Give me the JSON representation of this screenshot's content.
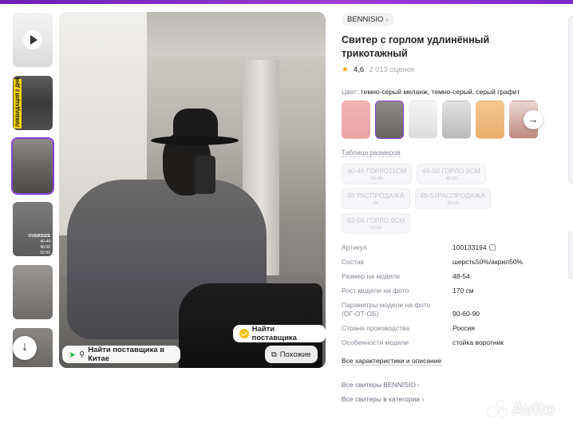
{
  "gallery": {
    "thumb_tag": "ЛИКВИДАЦИЯ 2 ДНЯ",
    "thumb_oversize": {
      "label": "OVERSIZE",
      "lines": [
        "40-44",
        "46-50",
        "52-56"
      ]
    },
    "buttons": {
      "find_supplier": "Найти поставщика",
      "find_supplier_china": "Найти поставщика в Китае",
      "similar": "Похожие"
    }
  },
  "product": {
    "brand": "BENNISIO",
    "title": "Свитер с горлом удлинённый трикотажный",
    "rating": "4,6",
    "reviews": "2 013 оценок",
    "color_label": "Цвет:",
    "color_value": "темно-серый меланж, темно-серый, серый графит",
    "size_table_link": "Таблица размеров",
    "sizes": [
      {
        "name": "40-46 ГОРЛО11СМ",
        "sub": "40-46"
      },
      {
        "name": "46-50 ГОРЛО 9СМ",
        "sub": "46-50"
      },
      {
        "name": "48 РАСПРОДАЖА",
        "sub": "48"
      },
      {
        "name": "48-54РАСПРОДАЖА",
        "sub": "48-54"
      },
      {
        "name": "52-56 ГОРЛО 9СМ",
        "sub": "52-56"
      }
    ],
    "specs": [
      {
        "key": "Артикул",
        "value": "100133194"
      },
      {
        "key": "Состав",
        "value": "шерсть50%/акрил50%"
      },
      {
        "key": "Размер на модели",
        "value": "48-54"
      },
      {
        "key": "Рост модели на фото",
        "value": "170 см"
      },
      {
        "key": "Параметры модели на фото (ОГ-ОТ-ОБ)",
        "value": "90-60-90"
      },
      {
        "key": "Страна производства",
        "value": "Россия"
      },
      {
        "key": "Особенности модели",
        "value": "стойка воротник"
      }
    ],
    "all_specs_link": "Все характеристики и описание",
    "links": [
      "Все свитеры BENNISIO",
      "Все свитеры в категории"
    ]
  },
  "watermark": "Avito",
  "colors": {
    "accent": "#8a3ed6",
    "rating_star": "#f3a500",
    "supplier_badge": "#f5c400"
  }
}
